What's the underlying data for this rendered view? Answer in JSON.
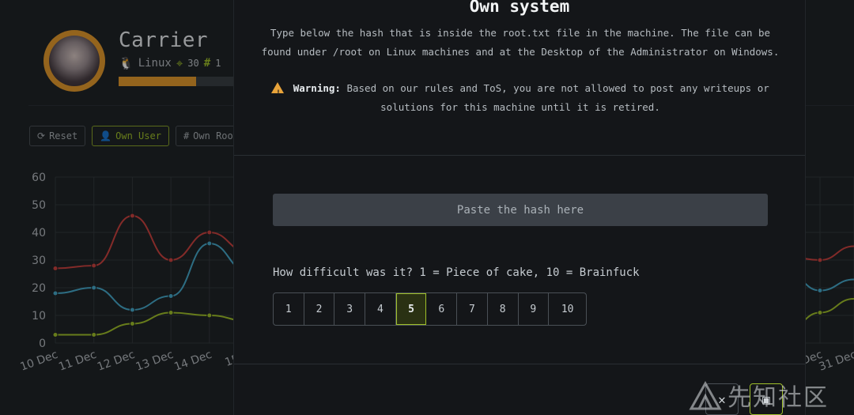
{
  "machine": {
    "name": "Carrier",
    "os": "Linux",
    "points": "30",
    "hash_count": "1",
    "progress": 0.65
  },
  "actions": {
    "reset": "Reset",
    "own_user": "Own User",
    "own_root": "Own Roo"
  },
  "chart_data": {
    "type": "line",
    "categories": [
      "10 Dec",
      "11 Dec",
      "12 Dec",
      "13 Dec",
      "14 Dec",
      "15 D"
    ],
    "right_categories": [
      "Dec",
      "31 Dec"
    ],
    "y_ticks": [
      "60",
      "50",
      "40",
      "30",
      "20",
      "10",
      "0"
    ],
    "ylim": [
      0,
      60
    ],
    "series": [
      {
        "values": [
          27,
          28,
          46,
          30,
          40,
          33
        ],
        "right_values": [
          30,
          35
        ],
        "color": "#c9423f"
      },
      {
        "values": [
          18,
          20,
          12,
          17,
          36,
          26
        ],
        "right_values": [
          19,
          23
        ],
        "color": "#46a8c9"
      },
      {
        "values": [
          3,
          3,
          7,
          11,
          10,
          8
        ],
        "right_values": [
          11,
          16
        ],
        "color": "#9fbf2a"
      }
    ]
  },
  "modal": {
    "title": "Own system",
    "description": "Type below the hash that is inside the root.txt file in the machine. The file can be found under /root on Linux machines and at the Desktop of the Administrator on Windows.",
    "warning_label": "Warning:",
    "warning_text": "Based on our rules and ToS, you are not allowed to post any writeups or solutions for this machine until it is retired.",
    "hash_placeholder": "Paste the hash here",
    "difficulty_question": "How difficult was it? 1 = Piece of cake, 10 = Brainfuck",
    "difficulty_options": [
      "1",
      "2",
      "3",
      "4",
      "5",
      "6",
      "7",
      "8",
      "9",
      "10"
    ],
    "difficulty_selected": "5",
    "close_glyph": "✕",
    "submit_glyph": "▣"
  },
  "watermark": {
    "text": "先知社区"
  },
  "colors": {
    "accent": "#9fbf2a",
    "progress": "#e39a2d",
    "warning": "#e8a33a"
  }
}
